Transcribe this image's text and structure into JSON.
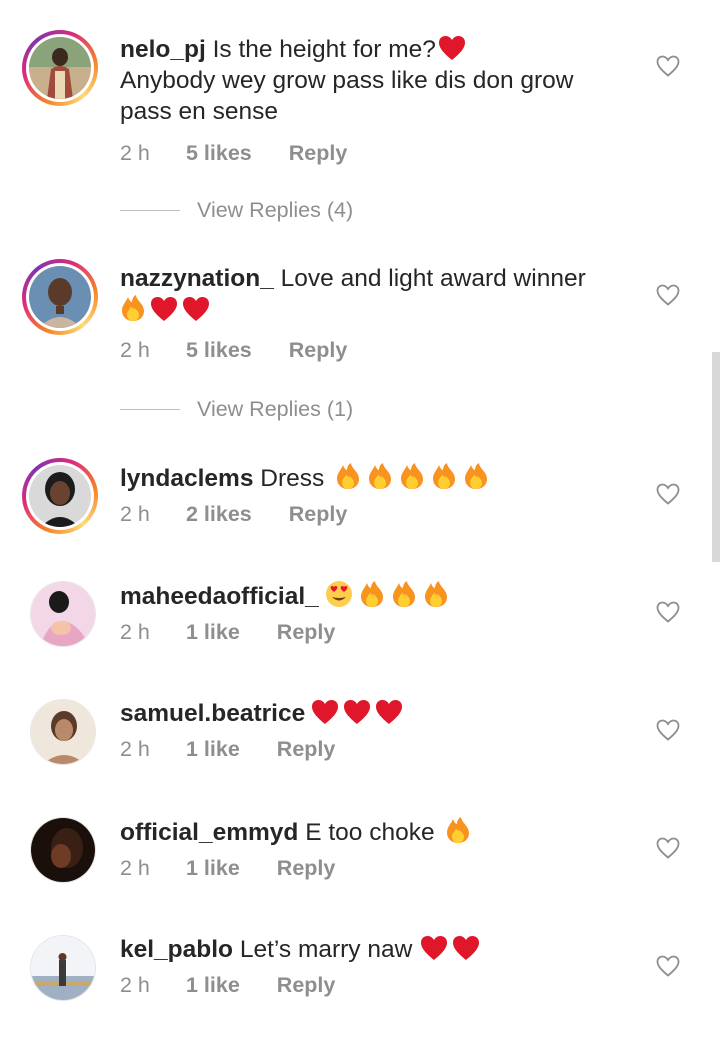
{
  "comments": [
    {
      "username": "nelo_pj",
      "text": "Is the height for me?",
      "emoji_inline": [
        "heart"
      ],
      "text2": "Anybody wey grow pass like dis don grow pass en sense",
      "time": "2 h",
      "likes": "5 likes",
      "reply": "Reply",
      "avatar_ring": true,
      "avatar_colors": [
        "#3b2b1e",
        "#a24a3c",
        "#c8b08c"
      ]
    },
    {
      "username": "nazzynation_",
      "text": "Love and light award winner",
      "emoji_line": [
        "fire",
        "heart",
        "heart"
      ],
      "time": "2 h",
      "likes": "5 likes",
      "reply": "Reply",
      "avatar_ring": true,
      "avatar_colors": [
        "#6b8fb3",
        "#5a3a28",
        "#c9b5a0"
      ]
    },
    {
      "username": "lyndaclems",
      "text": "Dress",
      "emoji_inline": [
        "fire",
        "fire",
        "fire",
        "fire",
        "fire"
      ],
      "time": "2 h",
      "likes": "2 likes",
      "reply": "Reply",
      "avatar_ring": true,
      "avatar_colors": [
        "#d9d9d9",
        "#2a1b14",
        "#1c1c1c"
      ]
    },
    {
      "username": "maheedaofficial_",
      "text": "",
      "emoji_inline": [
        "heart-eyes",
        "fire",
        "fire",
        "fire"
      ],
      "time": "2 h",
      "likes": "1 like",
      "reply": "Reply",
      "avatar_ring": false,
      "avatar_colors": [
        "#f3d7e6",
        "#e9a6c4",
        "#ffffff"
      ]
    },
    {
      "username": "samuel.beatrice",
      "text": "",
      "emoji_inline": [
        "heart",
        "heart",
        "heart"
      ],
      "time": "2 h",
      "likes": "1 like",
      "reply": "Reply",
      "avatar_ring": false,
      "avatar_colors": [
        "#efe6dc",
        "#b98a6a",
        "#5a3a28"
      ]
    },
    {
      "username": "official_emmyd",
      "text": "E too choke",
      "emoji_inline": [
        "fire"
      ],
      "time": "2 h",
      "likes": "1 like",
      "reply": "Reply",
      "avatar_ring": false,
      "avatar_colors": [
        "#1a0f0a",
        "#6e3b25",
        "#3a2014"
      ]
    },
    {
      "username": "kel_pablo",
      "text": "Let’s marry naw",
      "emoji_inline": [
        "heart",
        "heart"
      ],
      "time": "2 h",
      "likes": "1 like",
      "reply": "Reply",
      "avatar_ring": false,
      "avatar_colors": [
        "#f2f4f7",
        "#9fb0c4",
        "#3a3a3a"
      ]
    }
  ],
  "view_replies": [
    {
      "label": "View Replies (4)"
    },
    {
      "label": "View Replies (1)"
    }
  ],
  "icons": {
    "like": "heart-outline-icon",
    "fire": "fire-emoji",
    "heart": "red-heart-emoji",
    "heart_eyes": "heart-eyes-emoji"
  },
  "colors": {
    "text": "#262626",
    "meta": "#8e8e8e",
    "heart_red": "#e0162b",
    "fire": "#f7931e"
  }
}
